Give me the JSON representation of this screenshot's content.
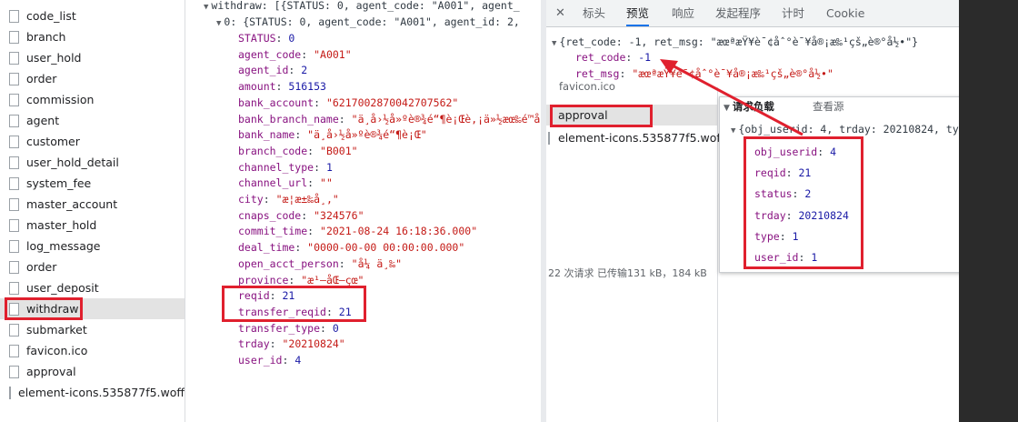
{
  "left_list": {
    "items": [
      {
        "label": "code_list"
      },
      {
        "label": "branch"
      },
      {
        "label": "user_hold"
      },
      {
        "label": "order"
      },
      {
        "label": "commission"
      },
      {
        "label": "agent"
      },
      {
        "label": "customer"
      },
      {
        "label": "user_hold_detail"
      },
      {
        "label": "system_fee"
      },
      {
        "label": "master_account"
      },
      {
        "label": "master_hold"
      },
      {
        "label": "log_message"
      },
      {
        "label": "order"
      },
      {
        "label": "user_deposit"
      },
      {
        "label": "withdraw"
      },
      {
        "label": "submarket"
      },
      {
        "label": "favicon.ico"
      },
      {
        "label": "approval"
      },
      {
        "label": "element-icons.535877f5.woff"
      }
    ],
    "selected_label": "withdraw"
  },
  "middle_preview": {
    "root_line": "withdraw: [{STATUS: 0, agent_code: \"A001\", agent_",
    "item_line": "0: {STATUS: 0, agent_code: \"A001\", agent_id: 2,",
    "fields": [
      {
        "key": "STATUS",
        "value": "0",
        "kind": "n"
      },
      {
        "key": "agent_code",
        "value": "\"A001\"",
        "kind": "s"
      },
      {
        "key": "agent_id",
        "value": "2",
        "kind": "n"
      },
      {
        "key": "amount",
        "value": "516153",
        "kind": "n"
      },
      {
        "key": "bank_account",
        "value": "\"6217002870042707562\"",
        "kind": "s"
      },
      {
        "key": "bank_branch_name",
        "value": "\"ä¸å›½å»ºè®¾é“¶è¡Œè,¡ä»½æœ‰é™å…¬å\"",
        "kind": "s"
      },
      {
        "key": "bank_name",
        "value": "\"ä¸å›½å»ºè®¾é“¶è¡Œ\"",
        "kind": "s"
      },
      {
        "key": "branch_code",
        "value": "\"B001\"",
        "kind": "s"
      },
      {
        "key": "channel_type",
        "value": "1",
        "kind": "n"
      },
      {
        "key": "channel_url",
        "value": "\"\"",
        "kind": "s"
      },
      {
        "key": "city",
        "value": "\"æ¦æ±‰å¸‚\"",
        "kind": "s"
      },
      {
        "key": "cnaps_code",
        "value": "\"324576\"",
        "kind": "s"
      },
      {
        "key": "commit_time",
        "value": "\"2021-08-24 16:18:36.000\"",
        "kind": "s"
      },
      {
        "key": "deal_time",
        "value": "\"0000-00-00 00:00:00.000\"",
        "kind": "s"
      },
      {
        "key": "open_acct_person",
        "value": "\"å¼ ä¸‰\"",
        "kind": "s"
      },
      {
        "key": "province",
        "value": "\"æ¹–åŒ—çœ\"",
        "kind": "s"
      },
      {
        "key": "reqid",
        "value": "21",
        "kind": "n"
      },
      {
        "key": "transfer_reqid",
        "value": "21",
        "kind": "n"
      },
      {
        "key": "transfer_type",
        "value": "0",
        "kind": "n"
      },
      {
        "key": "trday",
        "value": "\"20210824\"",
        "kind": "s"
      },
      {
        "key": "user_id",
        "value": "4",
        "kind": "n"
      }
    ]
  },
  "devtools": {
    "close_label": "✕",
    "tabs": [
      {
        "label": "标头",
        "active": false
      },
      {
        "label": "预览",
        "active": true
      },
      {
        "label": "响应",
        "active": false
      },
      {
        "label": "发起程序",
        "active": false
      },
      {
        "label": "计时",
        "active": false
      },
      {
        "label": "Cookie",
        "active": false
      }
    ],
    "preview_root": "{ret_code: -1, ret_msg: \"æœªæŸ¥è¯¢åˆ°è¯¥å®¡æ‰¹çš„è®°å½•\"}",
    "ret_code_key": "ret_code",
    "ret_code_value": "-1",
    "ret_msg_key": "ret_msg",
    "ret_msg_value": "\"æœªæŸ¥è¯¢åˆ°è¯¥å®¡æ‰¹çš„è®°å½•\"",
    "inner_list": {
      "partial_item": "favicon.ico",
      "items": [
        {
          "label": "approval"
        },
        {
          "label": "element-icons.535877f5.woff"
        }
      ],
      "status_text": "22 次请求  已传输131 kB，184 kB"
    },
    "payload": {
      "tab_payload": "请求负载",
      "tab_source": "查看源",
      "root_line": "{obj_userid: 4, trday: 20210824, type: 1,",
      "fields": [
        {
          "key": "obj_userid",
          "value": "4"
        },
        {
          "key": "reqid",
          "value": "21"
        },
        {
          "key": "status",
          "value": "2"
        },
        {
          "key": "trday",
          "value": "20210824"
        },
        {
          "key": "type",
          "value": "1"
        },
        {
          "key": "user_id",
          "value": "1"
        }
      ]
    }
  },
  "colors": {
    "highlight_red": "#e0202e",
    "key_purple": "#881280",
    "string_red": "#c41a16",
    "number_blue": "#1a1aa6",
    "active_tab_blue": "#1a73e8"
  }
}
